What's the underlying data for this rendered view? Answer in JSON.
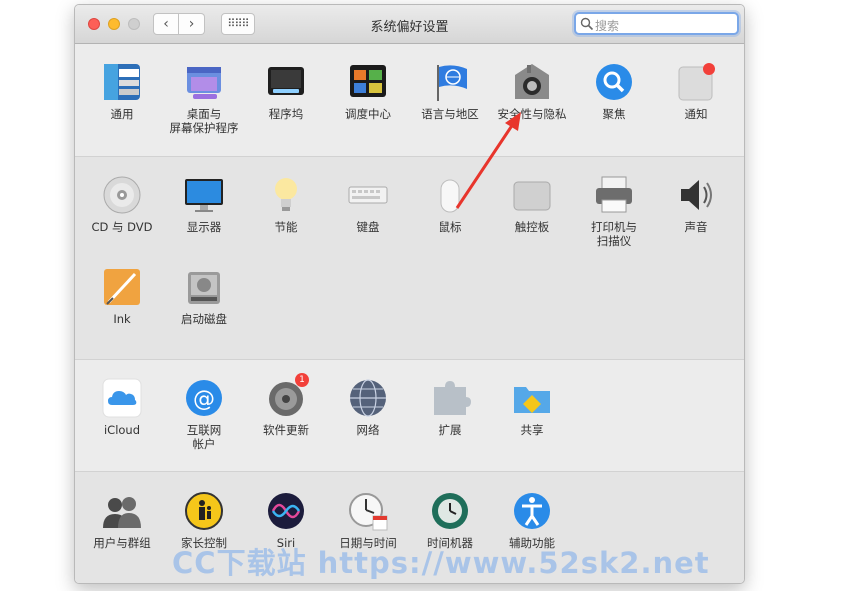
{
  "window": {
    "title": "系统偏好设置",
    "search_placeholder": "搜索",
    "nav_back": "‹",
    "nav_forward": "›",
    "grid_label": "⠿⠿⠿"
  },
  "sections": [
    {
      "items": [
        {
          "label": "通用",
          "icon": "general-icon"
        },
        {
          "label": "桌面与\n屏幕保护程序",
          "icon": "desktop-screensaver-icon"
        },
        {
          "label": "程序坞",
          "icon": "dock-icon"
        },
        {
          "label": "调度中心",
          "icon": "mission-control-icon"
        },
        {
          "label": "语言与地区",
          "icon": "language-region-icon"
        },
        {
          "label": "安全性与隐私",
          "icon": "security-privacy-icon"
        },
        {
          "label": "聚焦",
          "icon": "spotlight-icon"
        },
        {
          "label": "通知",
          "icon": "notifications-icon"
        }
      ]
    },
    {
      "items": [
        {
          "label": "CD 与 DVD",
          "icon": "cd-dvd-icon"
        },
        {
          "label": "显示器",
          "icon": "displays-icon"
        },
        {
          "label": "节能",
          "icon": "energy-saver-icon"
        },
        {
          "label": "键盘",
          "icon": "keyboard-icon"
        },
        {
          "label": "鼠标",
          "icon": "mouse-icon"
        },
        {
          "label": "触控板",
          "icon": "trackpad-icon"
        },
        {
          "label": "打印机与\n扫描仪",
          "icon": "printers-scanners-icon"
        },
        {
          "label": "声音",
          "icon": "sound-icon"
        },
        {
          "label": "Ink",
          "icon": "ink-icon"
        },
        {
          "label": "启动磁盘",
          "icon": "startup-disk-icon"
        }
      ]
    },
    {
      "items": [
        {
          "label": "iCloud",
          "icon": "icloud-icon"
        },
        {
          "label": "互联网\n帐户",
          "icon": "internet-accounts-icon"
        },
        {
          "label": "软件更新",
          "icon": "software-update-icon",
          "badge": "1"
        },
        {
          "label": "网络",
          "icon": "network-icon"
        },
        {
          "label": "扩展",
          "icon": "extensions-icon"
        },
        {
          "label": "共享",
          "icon": "sharing-icon"
        }
      ]
    },
    {
      "items": [
        {
          "label": "用户与群组",
          "icon": "users-groups-icon"
        },
        {
          "label": "家长控制",
          "icon": "parental-controls-icon"
        },
        {
          "label": "Siri",
          "icon": "siri-icon"
        },
        {
          "label": "日期与时间",
          "icon": "date-time-icon"
        },
        {
          "label": "时间机器",
          "icon": "time-machine-icon"
        },
        {
          "label": "辅助功能",
          "icon": "accessibility-icon"
        }
      ]
    }
  ],
  "watermark": "CC下载站 https://www.52sk2.net",
  "colors": {
    "accent": "#7aa7e8",
    "annotation_arrow": "#e8352c",
    "badge": "#f2403a"
  }
}
